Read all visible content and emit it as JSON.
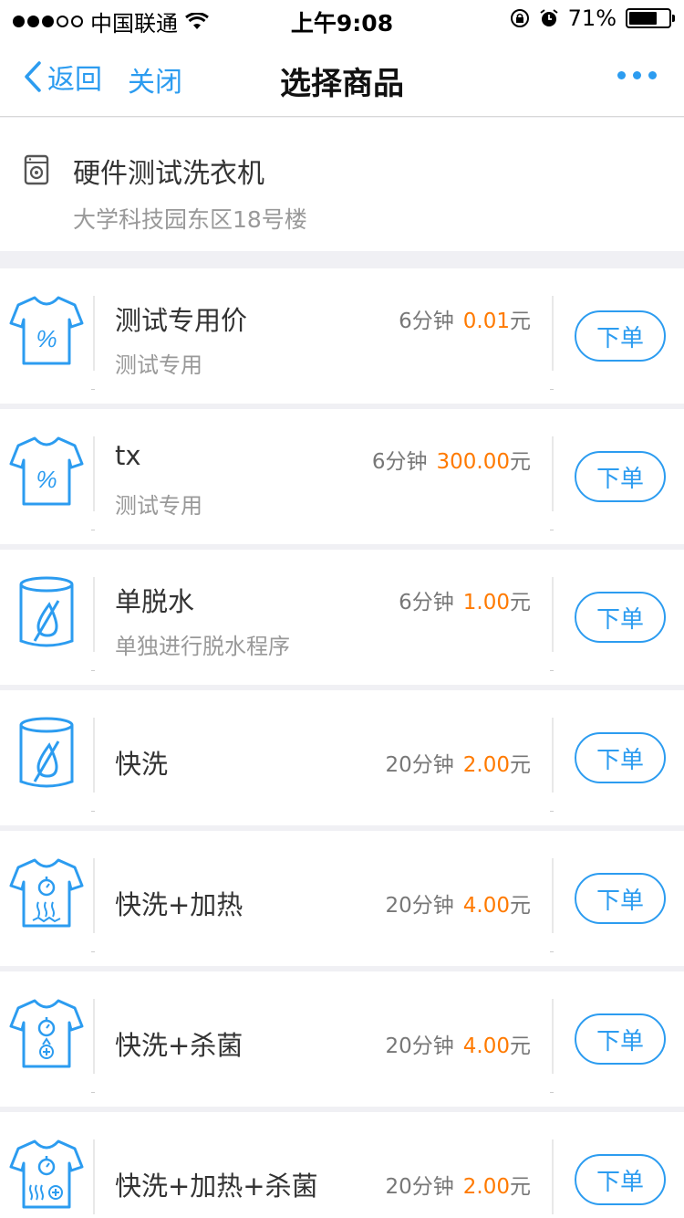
{
  "status_bar": {
    "carrier": "中国联通",
    "time": "上午9:08",
    "battery": "71%",
    "battery_level": 0.71
  },
  "nav": {
    "back_label": "返回",
    "close_label": "关闭",
    "title": "选择商品"
  },
  "device": {
    "name": "硬件测试洗衣机",
    "address": "大学科技园东区18号楼"
  },
  "products": [
    {
      "name": "测试专用价",
      "desc": "测试专用",
      "duration": "6分钟",
      "price": "0.01",
      "unit": "元",
      "icon": "tshirt-percent-icon",
      "button": "下单"
    },
    {
      "name": "tx",
      "desc": "测试专用",
      "duration": "6分钟",
      "price": "300.00",
      "unit": "元",
      "icon": "tshirt-percent-icon",
      "button": "下单"
    },
    {
      "name": "单脱水",
      "desc": "单独进行脱水程序",
      "duration": "6分钟",
      "price": "1.00",
      "unit": "元",
      "icon": "drum-no-water-icon",
      "button": "下单"
    },
    {
      "name": "快洗",
      "desc": "",
      "duration": "20分钟",
      "price": "2.00",
      "unit": "元",
      "icon": "drum-no-water-icon",
      "button": "下单"
    },
    {
      "name": "快洗+加热",
      "desc": "",
      "duration": "20分钟",
      "price": "4.00",
      "unit": "元",
      "icon": "tshirt-timer-heat-icon",
      "button": "下单"
    },
    {
      "name": "快洗+杀菌",
      "desc": "",
      "duration": "20分钟",
      "price": "4.00",
      "unit": "元",
      "icon": "tshirt-timer-sterilize-icon",
      "button": "下单"
    },
    {
      "name": "快洗+加热+杀菌",
      "desc": "",
      "duration": "20分钟",
      "price": "2.00",
      "unit": "元",
      "icon": "tshirt-timer-heat-sterilize-icon",
      "button": "下单"
    }
  ]
}
